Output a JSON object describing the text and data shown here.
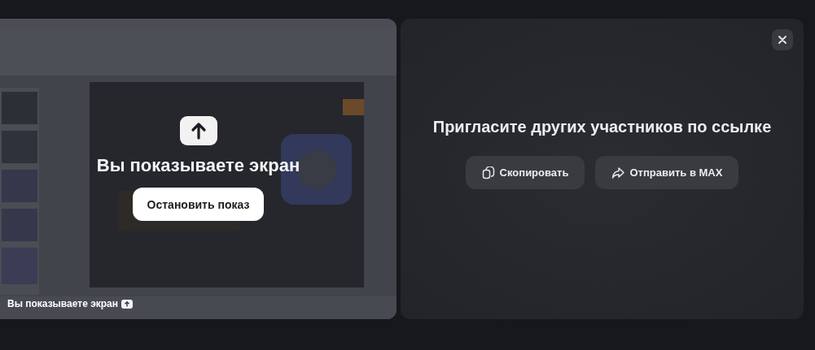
{
  "screen_share": {
    "title": "Вы показываете экран",
    "stop_button": "Остановить показ",
    "badge": "Вы показываете экран"
  },
  "invite_panel": {
    "title": "Пригласите других участников по ссылке",
    "actions": [
      {
        "kind": "copy",
        "label": "Скопировать"
      },
      {
        "kind": "share",
        "label": "Отправить в MAX"
      }
    ]
  }
}
